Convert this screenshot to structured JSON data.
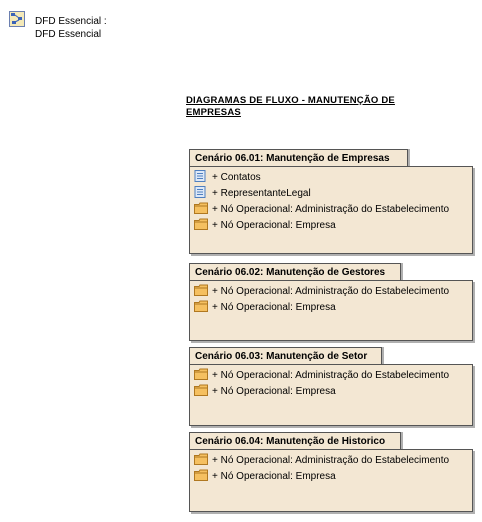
{
  "root": {
    "label_line1": "DFD Essencial :",
    "label_line2": "DFD Essencial",
    "icon": "dfd-diagram-icon"
  },
  "title": "DIAGRAMAS DE FLUXO - MANUTENÇÃO DE EMPRESAS",
  "packages": [
    {
      "name": "Cenário 06.01: Manutenção de Empresas",
      "items": [
        {
          "label": "+ Contatos",
          "icon": "data-store-icon"
        },
        {
          "label": "+ RepresentanteLegal",
          "icon": "data-store-icon"
        },
        {
          "label": "+ Nó Operacional: Administração do Estabelecimento",
          "icon": "folder-icon"
        },
        {
          "label": "+ Nó Operacional: Empresa",
          "icon": "folder-icon"
        }
      ]
    },
    {
      "name": "Cenário 06.02: Manutenção de Gestores",
      "items": [
        {
          "label": "+ Nó Operacional: Administração do Estabelecimento",
          "icon": "folder-icon"
        },
        {
          "label": "+ Nó Operacional: Empresa",
          "icon": "folder-icon"
        }
      ]
    },
    {
      "name": "Cenário 06.03: Manutenção de Setor",
      "items": [
        {
          "label": "+ Nó Operacional: Administração do Estabelecimento",
          "icon": "folder-icon"
        },
        {
          "label": "+ Nó Operacional: Empresa",
          "icon": "folder-icon"
        }
      ]
    },
    {
      "name": "Cenário 06.04: Manutenção de Historico",
      "items": [
        {
          "label": "+ Nó Operacional: Administração do Estabelecimento",
          "icon": "folder-icon"
        },
        {
          "label": "+ Nó Operacional: Empresa",
          "icon": "folder-icon"
        }
      ]
    }
  ],
  "colors": {
    "package_fill": "#f3e7d3",
    "border": "#555555",
    "folder": "#f5c060",
    "data_store": "#4f7fbf"
  }
}
